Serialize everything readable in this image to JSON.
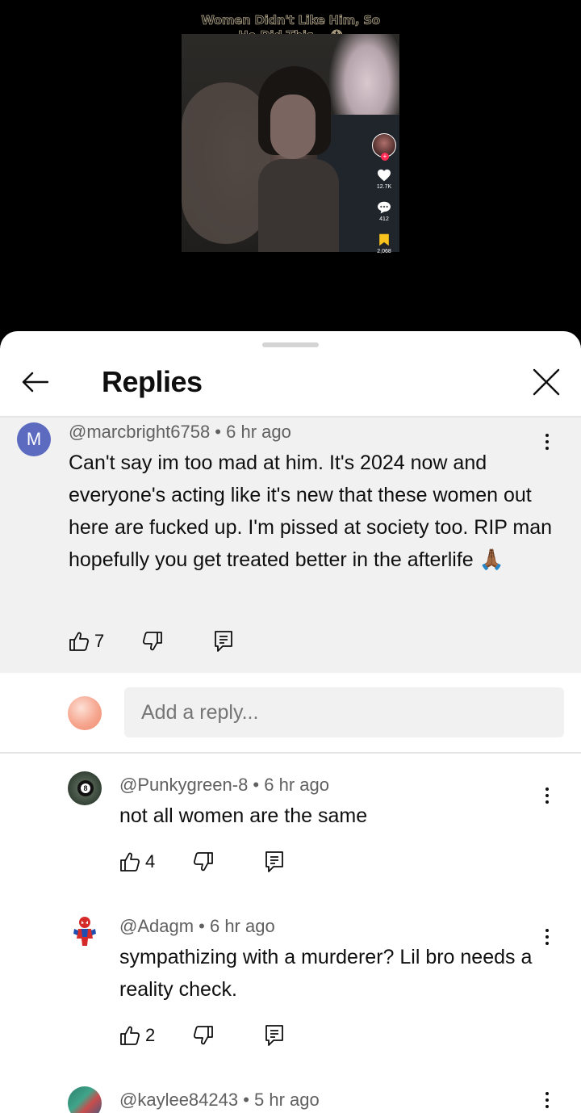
{
  "video": {
    "caption_line1": "Women Didn't Like Him, So",
    "caption_line2": "He Did This... 😰",
    "likes": "12.7K",
    "comments": "412",
    "saves": "2,068"
  },
  "sheet": {
    "title": "Replies"
  },
  "parent_comment": {
    "avatar_letter": "M",
    "avatar_color": "#5c6bc0",
    "meta": "@marcbright6758 • 6 hr ago",
    "text": "Can't say im too mad at him. It's 2024 now and everyone's acting like it's new that these women out here are fucked up. I'm pissed at society too. RIP man hopefully you get treated better in the afterlife 🙏🏾",
    "likes": "7"
  },
  "reply_input": {
    "placeholder": "Add a reply..."
  },
  "replies": [
    {
      "meta": "@Punkygreen-8 • 6 hr ago",
      "text": "not all women are the same",
      "likes": "4"
    },
    {
      "meta": "@Adagm • 6 hr ago",
      "text": "sympathizing with a murderer? Lil bro needs a reality check.",
      "likes": "2"
    },
    {
      "meta": "@kaylee84243 • 5 hr ago"
    }
  ]
}
